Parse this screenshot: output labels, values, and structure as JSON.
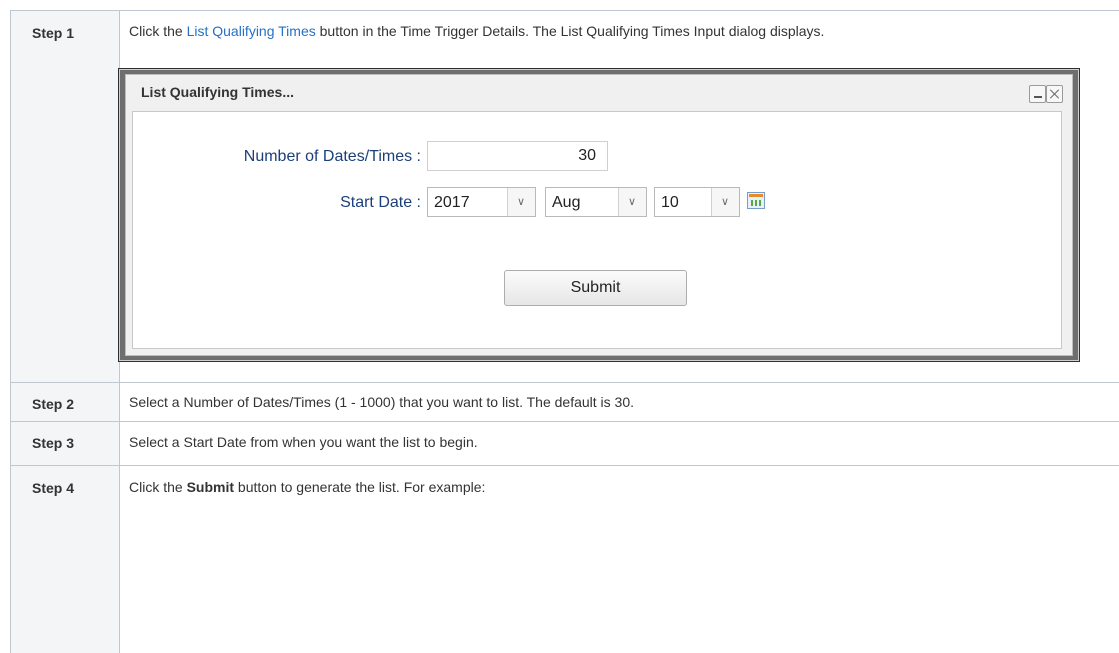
{
  "steps": [
    {
      "label": "Step 1",
      "text_before": "Click the ",
      "link": "List Qualifying Times",
      "text_after": " button in the Time Trigger Details. The List Qualifying Times Input dialog displays."
    },
    {
      "label": "Step 2",
      "text": "Select a Number of Dates/Times (1 - 1000) that you want to list. The default is 30."
    },
    {
      "label": "Step 3",
      "text": "Select a Start Date from when you want the list to begin."
    },
    {
      "label": "Step 4",
      "text_before": "Click the ",
      "bold": "Submit",
      "text_after": " button to generate the list. For example:"
    }
  ],
  "dialog": {
    "title": "List Qualifying Times...",
    "count_label": "Number of Dates/Times :",
    "count_value": "30",
    "start_label": "Start Date :",
    "year": "2017",
    "month": "Aug",
    "day": "10",
    "submit_label": "Submit",
    "calendar_icon": "calendar-icon",
    "minimize_icon": "minimize-icon",
    "close_icon": "close-icon",
    "dropdown_icon": "chevron-down-icon"
  }
}
